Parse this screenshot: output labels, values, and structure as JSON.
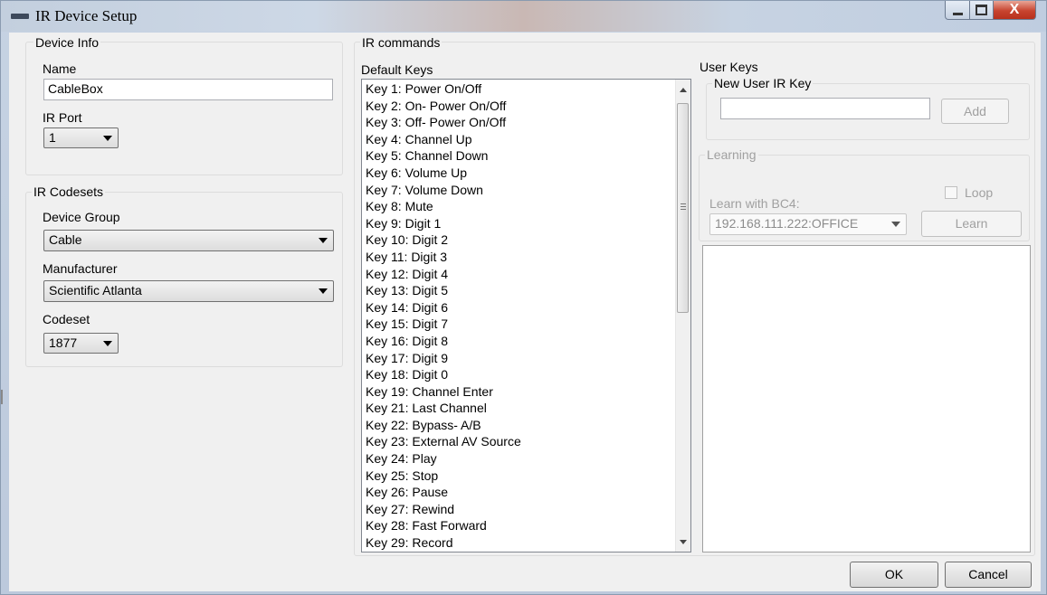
{
  "window": {
    "title": "IR Device Setup",
    "close_glyph": "X"
  },
  "device_info": {
    "legend": "Device Info",
    "name_label": "Name",
    "name_value": "CableBox",
    "ir_port_label": "IR Port",
    "ir_port_value": "1"
  },
  "codesets": {
    "legend": "IR Codesets",
    "device_group_label": "Device Group",
    "device_group_value": "Cable",
    "manufacturer_label": "Manufacturer",
    "manufacturer_value": "Scientific Atlanta",
    "codeset_label": "Codeset",
    "codeset_value": "1877"
  },
  "ir_commands": {
    "legend": "IR commands",
    "default_keys_label": "Default Keys",
    "default_keys": [
      "Key 1: Power On/Off",
      "Key 2: On- Power On/Off",
      "Key 3: Off- Power On/Off",
      "Key 4: Channel Up",
      "Key 5: Channel Down",
      "Key 6: Volume Up",
      "Key 7: Volume Down",
      "Key 8: Mute",
      "Key 9: Digit 1",
      "Key 10: Digit 2",
      "Key 11: Digit 3",
      "Key 12: Digit 4",
      "Key 13: Digit 5",
      "Key 14: Digit 6",
      "Key 15: Digit 7",
      "Key 16: Digit 8",
      "Key 17: Digit 9",
      "Key 18: Digit 0",
      "Key 19: Channel Enter",
      "Key 21: Last Channel",
      "Key 22: Bypass- A/B",
      "Key 23: External AV Source",
      "Key 24: Play",
      "Key 25: Stop",
      "Key 26: Pause",
      "Key 27: Rewind",
      "Key 28: Fast Forward",
      "Key 29: Record"
    ],
    "user_keys_label": "User Keys",
    "new_user_key_legend": "New User IR Key",
    "new_user_key_value": "",
    "add_label": "Add",
    "learning_legend": "Learning",
    "loop_label": "Loop",
    "learn_with_label": "Learn with BC4:",
    "learn_device_value": "192.168.111.222:OFFICE",
    "learn_label": "Learn"
  },
  "footer": {
    "ok_label": "OK",
    "cancel_label": "Cancel"
  },
  "colors": {
    "window_frame": "#c6d3e3",
    "dialog_background": "#f0f0f0",
    "close_button": "#c7442f",
    "disabled_text": "#a0a0a0"
  }
}
